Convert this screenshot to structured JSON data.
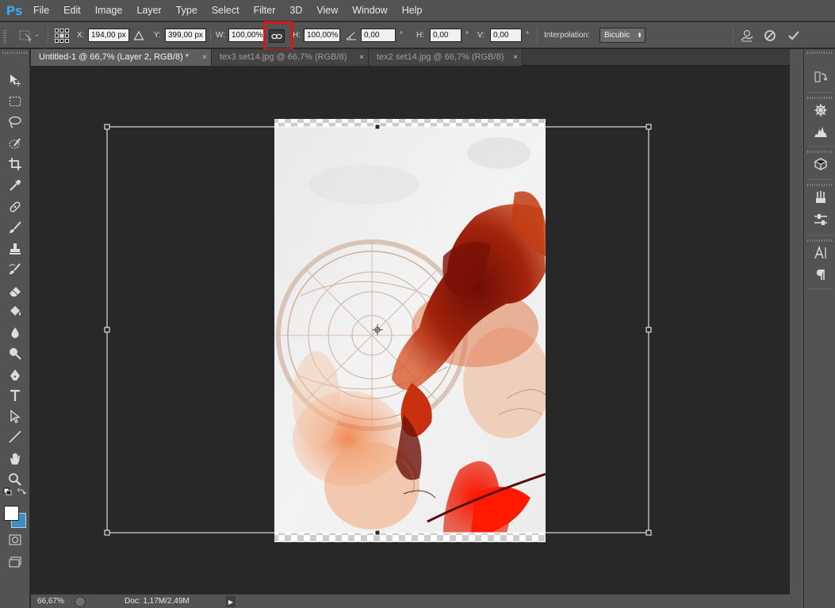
{
  "app": {
    "logo": "Ps"
  },
  "menu": [
    "File",
    "Edit",
    "Image",
    "Layer",
    "Type",
    "Select",
    "Filter",
    "3D",
    "View",
    "Window",
    "Help"
  ],
  "options": {
    "x_label": "X:",
    "x_value": "194,00 px",
    "y_label": "Y:",
    "y_value": "399,00 px",
    "w_label": "W:",
    "w_value": "100,00%",
    "h_label": "H:",
    "h_value": "100,00%",
    "angle_value": "0,00",
    "degree": "°",
    "hskew_label": "H:",
    "hskew_value": "0,00",
    "vskew_label": "V:",
    "vskew_value": "0,00",
    "interp_label": "Interpolation:",
    "interp_value": "Bicubic",
    "link_icon": "chain-link-icon",
    "highlight_color": "#e11414"
  },
  "tabs": [
    {
      "label": "Untitled-1 @ 66,7% (Layer 2, RGB/8) *",
      "close": "×",
      "active": true
    },
    {
      "label": "tex3 set14.jpg @ 66,7% (RGB/8)",
      "close": "×",
      "active": false
    },
    {
      "label": "tex2 set14.jpg @ 66,7% (RGB/8)",
      "close": "×",
      "active": false
    }
  ],
  "status": {
    "zoom": "66,67%",
    "doc": "Doc: 1,17M/2,49M",
    "arrow": "▶"
  },
  "colors": {
    "foreground": "#ffffff",
    "background": "#3b8fc7",
    "accent": "#37a5e8"
  }
}
